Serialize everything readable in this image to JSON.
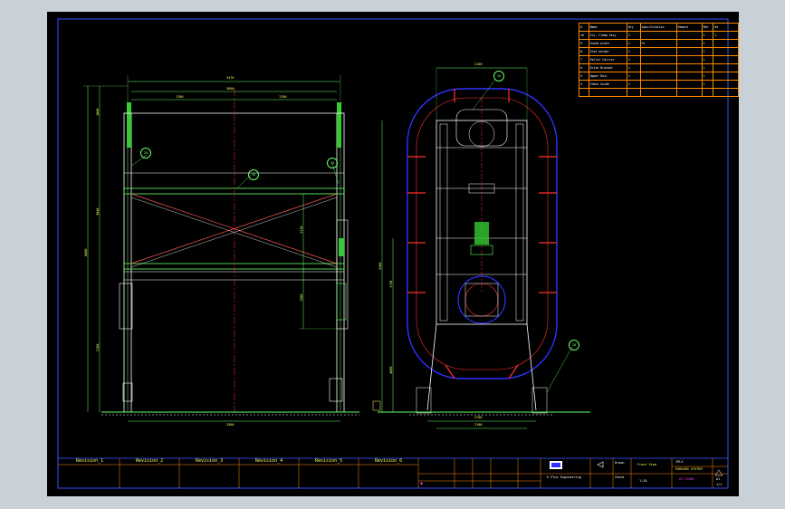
{
  "revisions": [
    "Revision_1",
    "Revision_2",
    "Revision_3",
    "Revision_4",
    "Revision_5",
    "Revision_6"
  ],
  "bom": {
    "header": [
      "#",
      "Name",
      "Qty",
      "Specification",
      "Remark",
      "Mat",
      "Wt"
    ],
    "rows": [
      [
        "10",
        "Inj. Clamp Assy",
        "1",
        "",
        "",
        "1",
        "1"
      ],
      [
        "9",
        "Guide plate",
        "1",
        "Fe",
        "",
        "1",
        ""
      ],
      [
        "8",
        "Slat holder",
        "1",
        "",
        "",
        "1",
        ""
      ],
      [
        "7",
        "Pallet Carrier",
        "1",
        "",
        "",
        "1",
        ""
      ],
      [
        "6",
        "Drive Bracket",
        "1",
        "",
        "",
        "1",
        ""
      ],
      [
        "5",
        "Upper Rail",
        "1",
        "",
        "",
        "1",
        ""
      ],
      [
        "4",
        "Chain Guide",
        "1",
        "",
        "",
        "1",
        ""
      ]
    ]
  },
  "dimensions": {
    "front_top_overall": "3470",
    "front_top_inner": "3090",
    "front_left_half": "1760",
    "front_right_half": "1760",
    "front_bottom": "3500",
    "front_left_total": "6000",
    "front_left_upper": "1000",
    "front_left_mid": "3040",
    "front_left_low": "2100",
    "front_right_mid": "1110",
    "front_right_low": "1300",
    "side_top": "2100",
    "side_height": "5300",
    "side_low": "1790",
    "side_bottom_1": "2700",
    "side_bottom_2": "2100",
    "side_left": "4600"
  },
  "balloons": [
    "20",
    "30",
    "40",
    "50",
    "60",
    "10"
  ],
  "title_block": {
    "company": "E-Plus Engineering",
    "drawing_no": "1PLS",
    "title_cn": "Front View",
    "scale": "1:20",
    "sheet": "1/1",
    "project": "PARKING SYSTEM",
    "code": "AT-CF001",
    "rev_box": "A1",
    "drawer_label": "Drawn",
    "check_label": "Check"
  },
  "colors": {
    "frame": "#ffffff",
    "steel": "#ffffff",
    "dimension": "#66ff66",
    "text": "#ffff66",
    "center_line": "#ff3030",
    "guide": "#3030ff",
    "border": "#3355ff"
  }
}
